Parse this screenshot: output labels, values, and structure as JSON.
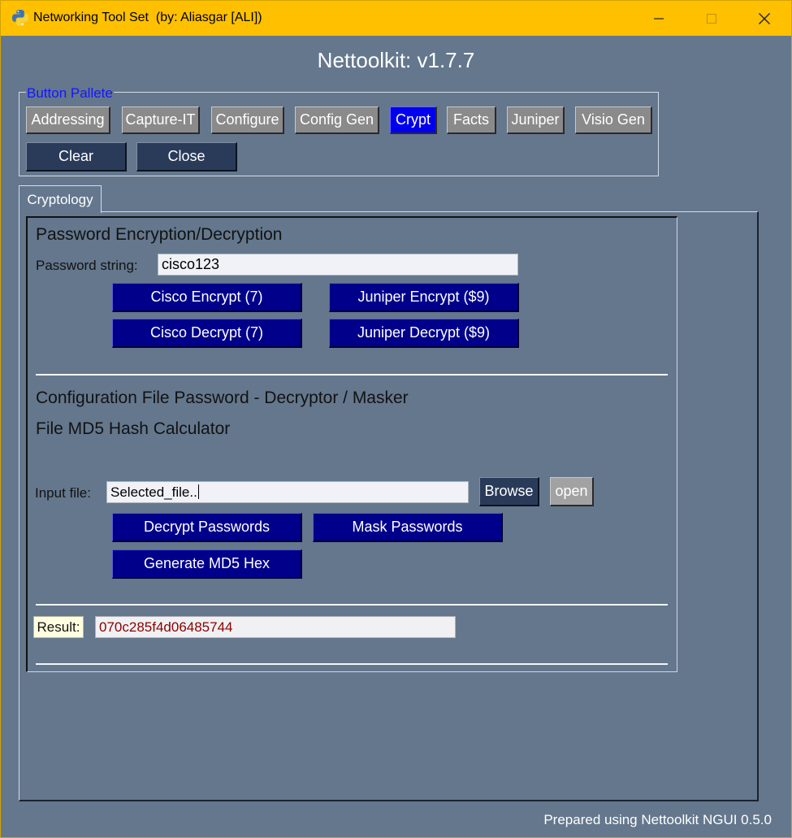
{
  "window": {
    "title": "Networking Tool Set  (by: Aliasgar [ALI])",
    "app_title": "Nettoolkit: v1.7.7",
    "footer": "Prepared using Nettoolkit NGUI 0.5.0",
    "title_bar_color": "#ffc000",
    "background_color": "#64778d"
  },
  "button_pallete": {
    "legend": "Button Pallete",
    "buttons": [
      "Addressing",
      "Capture-IT",
      "Configure",
      "Config Gen",
      "Crypt",
      "Facts",
      "Juniper",
      "Visio Gen"
    ],
    "active": "Crypt",
    "clear_label": "Clear",
    "close_label": "Close"
  },
  "tabs": [
    "Cryptology"
  ],
  "password_section": {
    "heading": "Password Encryption/Decryption",
    "input_label": "Password string:",
    "input_value": "cisco123",
    "cisco_encrypt": "Cisco Encrypt (7)",
    "juniper_encrypt": "Juniper Encrypt ($9)",
    "cisco_decrypt": "Cisco Decrypt (7)",
    "juniper_decrypt": "Juniper Decrypt ($9)"
  },
  "file_section": {
    "heading1": "Configuration File Password - Decryptor / Masker",
    "heading2": "File MD5 Hash Calculator",
    "input_label": "Input file:",
    "input_value": "Selected_file..",
    "browse": "Browse",
    "open": "open",
    "decrypt_passwords": "Decrypt Passwords",
    "mask_passwords": "Mask Passwords",
    "generate_md5": "Generate MD5 Hex"
  },
  "result": {
    "label": "Result:",
    "value": "070c285f4d06485744"
  },
  "icons": {
    "app": "python-icon",
    "minimize": "minimize-icon",
    "maximize": "maximize-icon",
    "close": "close-icon"
  }
}
